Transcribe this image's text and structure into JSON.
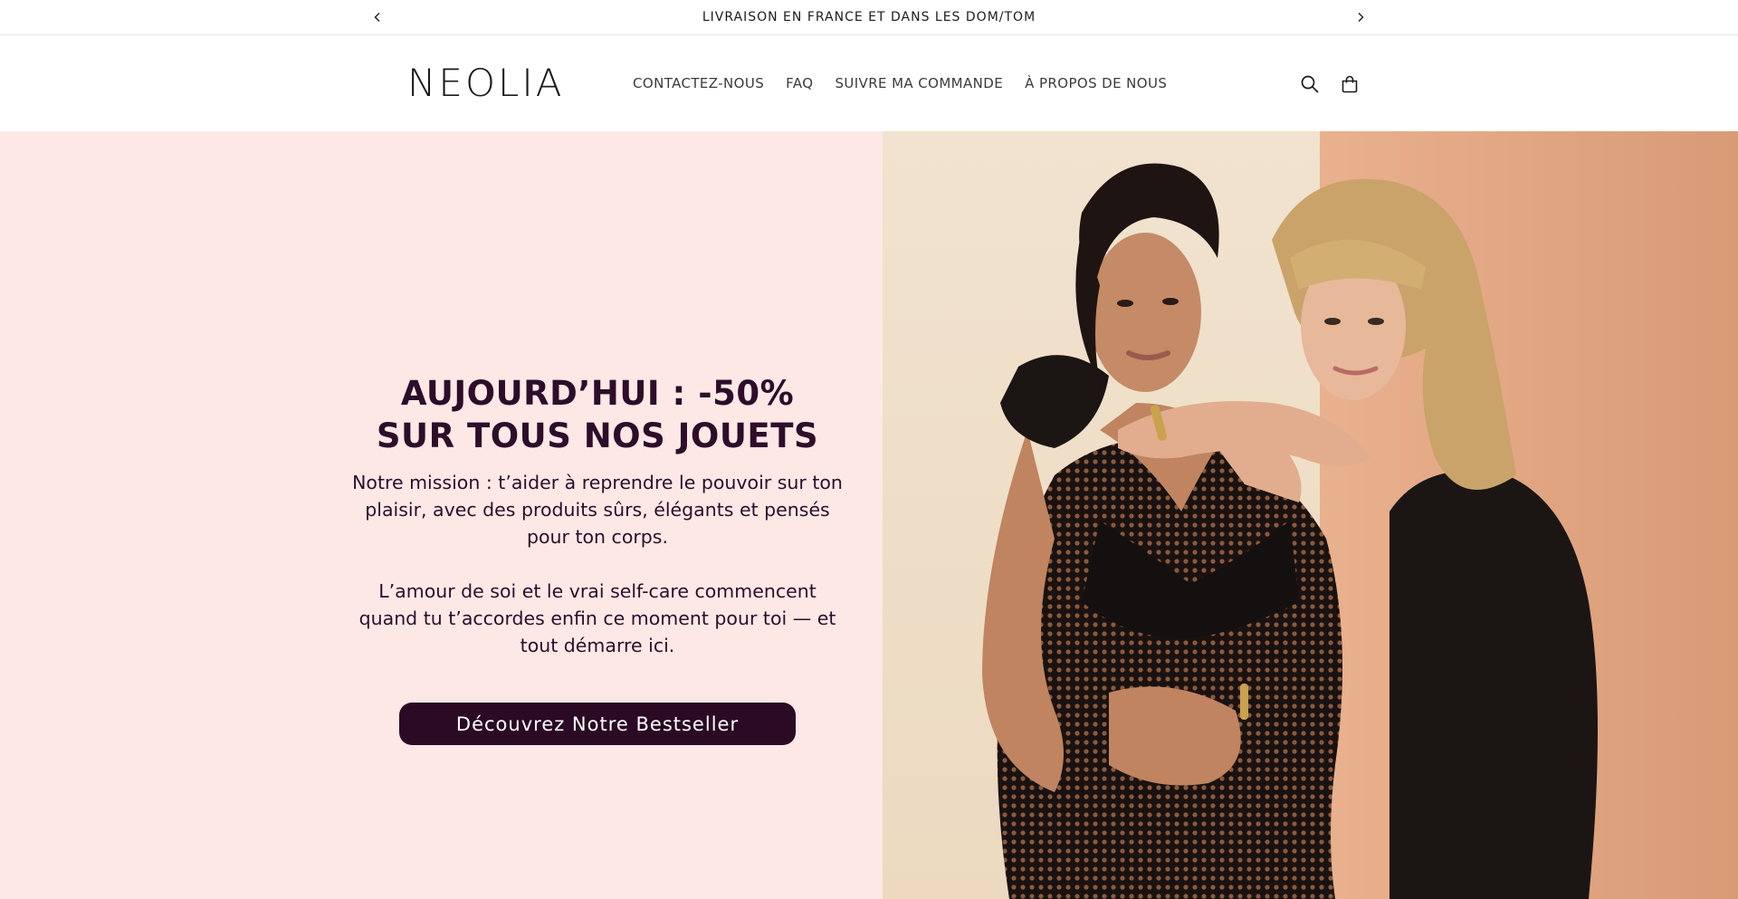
{
  "announcement": {
    "text": "LIVRAISON EN FRANCE ET DANS LES DOM/TOM",
    "prev_icon": "chevron-left-icon",
    "next_icon": "chevron-right-icon"
  },
  "header": {
    "logo": "NEOLIA",
    "nav": [
      {
        "label": "CONTACTEZ-NOUS"
      },
      {
        "label": "FAQ"
      },
      {
        "label": "SUIVRE MA COMMANDE"
      },
      {
        "label": "À PROPOS DE NOUS"
      }
    ],
    "icons": {
      "search": "search-icon",
      "cart": "cart-icon"
    }
  },
  "hero": {
    "title_line1": "AUJOURD’HUI : -50%",
    "title_line2": "SUR TOUS NOS JOUETS",
    "paragraph1": "Notre mission : t’aider à reprendre le pouvoir sur ton plaisir, avec des produits sûrs, élégants et pensés pour ton corps.",
    "paragraph2": "L’amour de soi et le vrai self-care commencent quand tu t’accordes enfin ce moment pour toi — et tout démarre ici.",
    "cta_label": "Découvrez Notre Bestseller"
  },
  "colors": {
    "hero_background": "#fde8e6",
    "text_primary": "#2d0d2a",
    "cta_background": "#2b0a24",
    "cta_text": "#ffffff"
  }
}
